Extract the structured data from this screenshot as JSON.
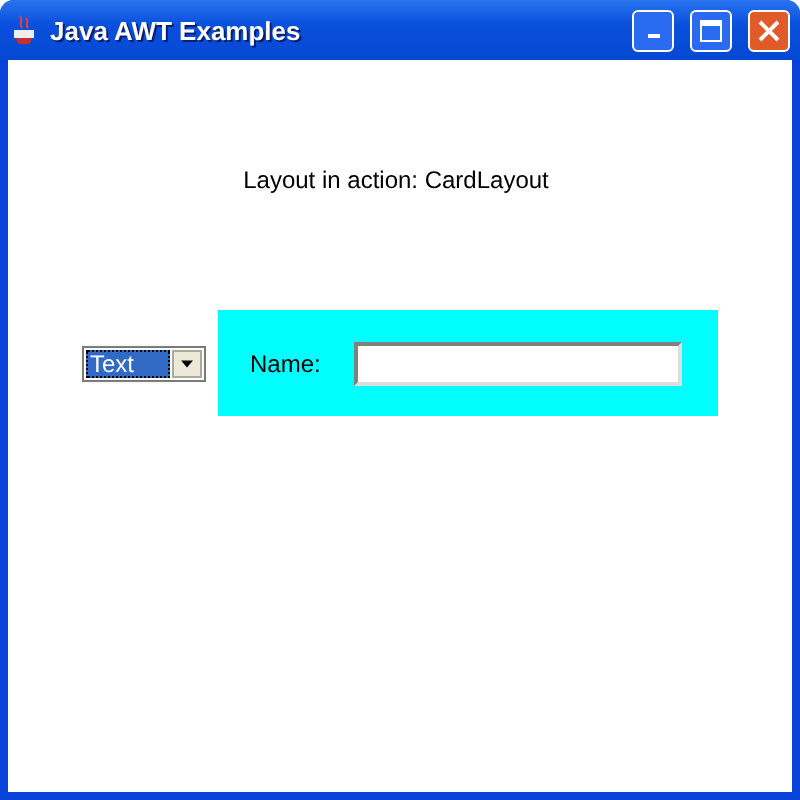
{
  "window": {
    "title": "Java AWT Examples"
  },
  "heading": "Layout in action: CardLayout",
  "choice": {
    "value": "Text"
  },
  "card": {
    "label": "Name:"
  }
}
